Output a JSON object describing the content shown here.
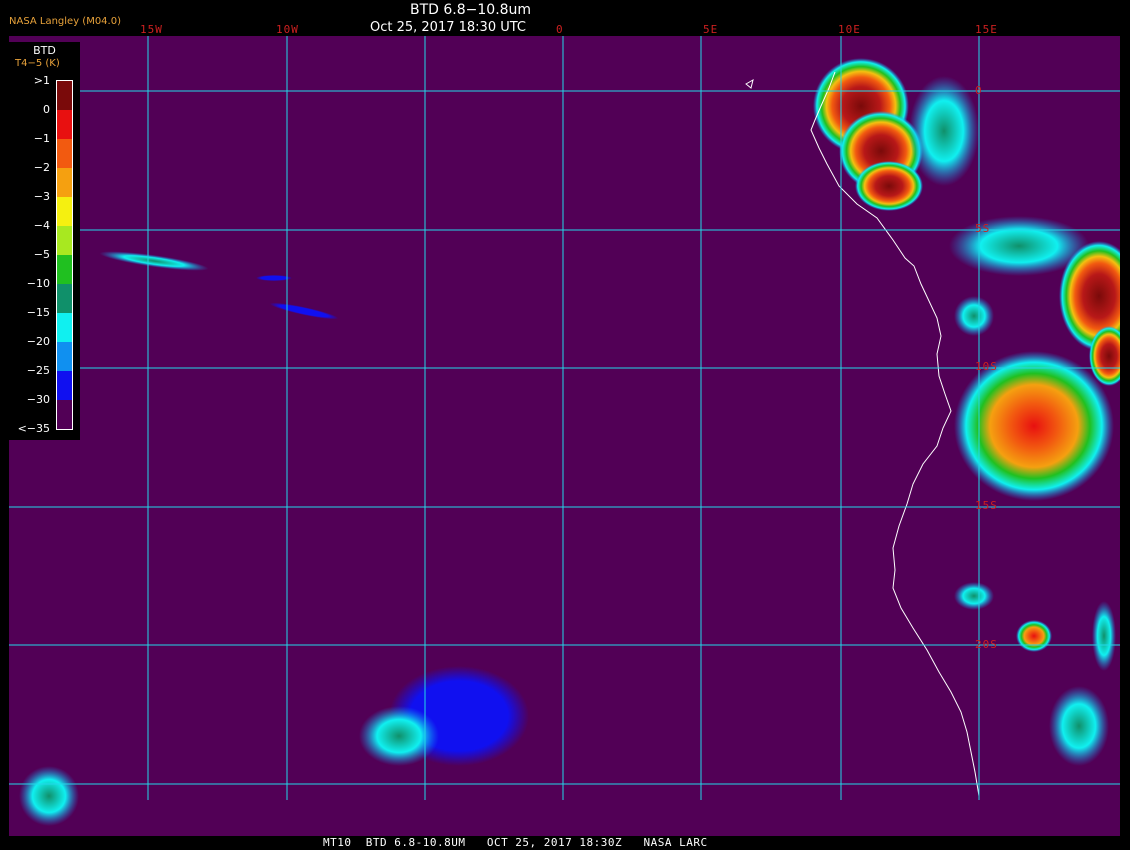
{
  "header": {
    "brand": "NASA Langley (M04.0)",
    "title": "BTD 6.8−10.8um",
    "datetime": "Oct 25, 2017 18:30 UTC"
  },
  "colors": {
    "background": "#520056",
    "grid": "#22d8e8",
    "coastline": "#ffffff",
    "label": "#cc2020",
    "brand": "#e8a23a"
  },
  "longitude_labels": [
    "15W",
    "10W",
    "0",
    "5E",
    "10E",
    "15E"
  ],
  "latitude_labels": [
    "0",
    "5S",
    "10S",
    "15S",
    "20S"
  ],
  "legend": {
    "title": "BTD",
    "subtitle": "T4−5 (K)",
    "ticks": [
      ">1",
      "0",
      "−1",
      "−2",
      "−3",
      "−4",
      "−5",
      "−10",
      "−15",
      "−20",
      "−25",
      "−30",
      "<−35"
    ],
    "colors": [
      "#7a0a0a",
      "#e81010",
      "#f25a10",
      "#f5a010",
      "#f5f010",
      "#a8e820",
      "#20c020",
      "#10906a",
      "#10f0f0",
      "#1090f0",
      "#1010f0",
      "#520056"
    ]
  },
  "footer": "MT10  BTD 6.8-10.8UM   OCT 25, 2017 18:30Z   NASA LARC"
}
